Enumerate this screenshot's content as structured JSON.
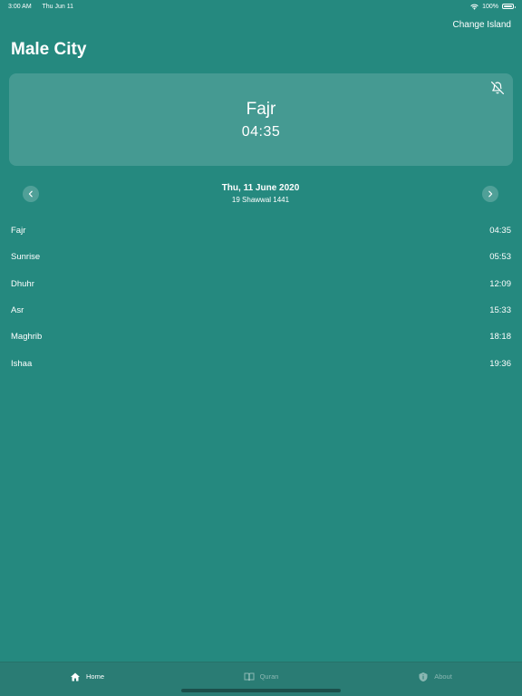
{
  "status": {
    "time": "3:00 AM",
    "date": "Thu Jun 11",
    "battery": "100%"
  },
  "header": {
    "change_island": "Change Island",
    "city": "Male City"
  },
  "next_prayer": {
    "name": "Fajr",
    "time": "04:35"
  },
  "date_nav": {
    "gregorian": "Thu, 11 June 2020",
    "hijri": "19 Shawwal 1441"
  },
  "prayers": [
    {
      "name": "Fajr",
      "time": "04:35"
    },
    {
      "name": "Sunrise",
      "time": "05:53"
    },
    {
      "name": "Dhuhr",
      "time": "12:09"
    },
    {
      "name": "Asr",
      "time": "15:33"
    },
    {
      "name": "Maghrib",
      "time": "18:18"
    },
    {
      "name": "Ishaa",
      "time": "19:36"
    }
  ],
  "tabs": [
    {
      "label": "Home",
      "icon": "house-icon",
      "active": true
    },
    {
      "label": "Quran",
      "icon": "book-icon",
      "active": false
    },
    {
      "label": "About",
      "icon": "info-icon",
      "active": false
    }
  ],
  "colors": {
    "background": "#25897f",
    "card": "#4aa39a",
    "tab_bar": "#2a7c74"
  }
}
